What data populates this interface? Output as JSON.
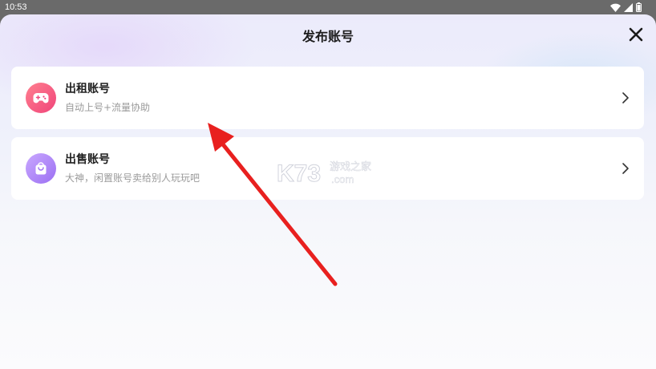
{
  "status_bar": {
    "time": "10:53",
    "icons": [
      "wifi-icon",
      "signal-icon",
      "battery-icon"
    ]
  },
  "sheet": {
    "title": "发布账号",
    "close_icon": "close-icon"
  },
  "options": [
    {
      "title": "出租账号",
      "subtitle": "自动上号+流量协助",
      "icon": "gamepad-icon",
      "icon_color": "#f0457a"
    },
    {
      "title": "出售账号",
      "subtitle": "大神，闲置账号卖给别人玩玩吧",
      "icon": "shopping-bag-icon",
      "icon_color": "#9b6ff2"
    }
  ],
  "watermark": {
    "brand": "K73",
    "line1": "游戏之家",
    "line2": ".com"
  },
  "annotation": {
    "color": "#e8201f"
  }
}
